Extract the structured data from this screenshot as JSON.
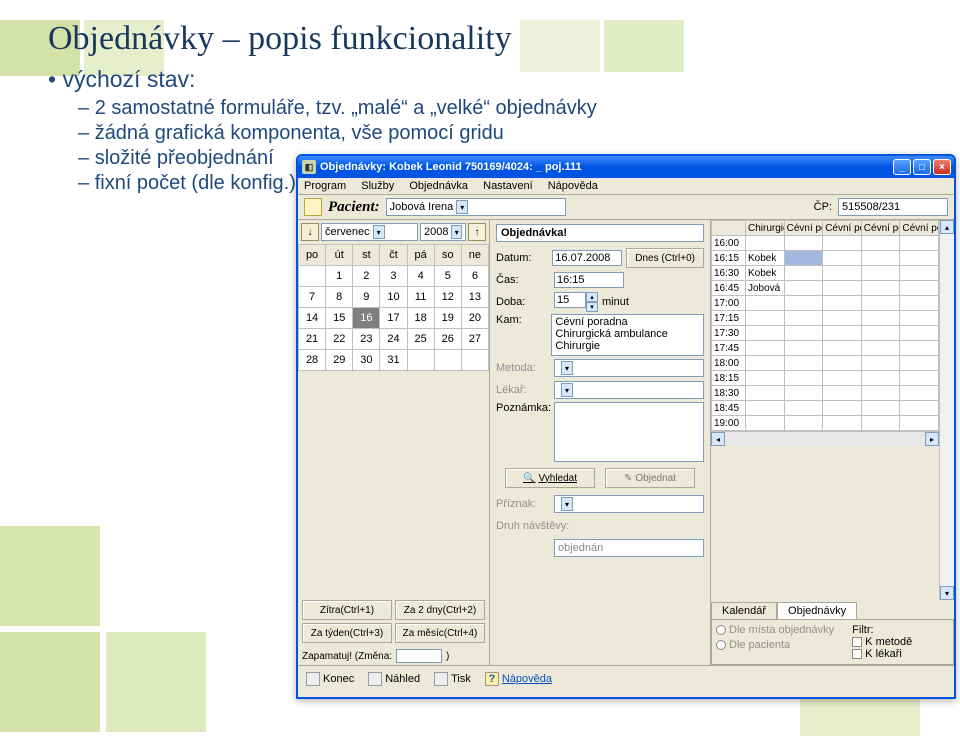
{
  "slide": {
    "title": "Objednávky – popis funkcionality",
    "l1": "výchozí stav:",
    "l2a": "2 samostatné formuláře, tzv. „malé“ a „velké“ objednávky",
    "l2b": "žádná grafická komponenta, vše pomocí gridu",
    "l2c": "složité přeobjednání",
    "l2d": "fixní počet (dle konfig.) objednávek na čas"
  },
  "window": {
    "title": "Objednávky: Kobek Leonid 750169/4024: _ poj.111"
  },
  "menu": [
    "Program",
    "Služby",
    "Objednávka",
    "Nastavení",
    "Nápověda"
  ],
  "toolbar": {
    "pacient_label": "Pacient:",
    "pacient_value": "Jobová Irena",
    "cp_label": "ČP:",
    "cp_value": "515508/231"
  },
  "calendar": {
    "month": "červenec",
    "year": "2008",
    "days": [
      "po",
      "út",
      "st",
      "čt",
      "pá",
      "so",
      "ne"
    ],
    "rows": [
      [
        "",
        "1",
        "2",
        "3",
        "4",
        "5",
        "6"
      ],
      [
        "7",
        "8",
        "9",
        "10",
        "11",
        "12",
        "13"
      ],
      [
        "14",
        "15",
        "16",
        "17",
        "18",
        "19",
        "20"
      ],
      [
        "21",
        "22",
        "23",
        "24",
        "25",
        "26",
        "27"
      ],
      [
        "28",
        "29",
        "30",
        "31",
        "",
        "",
        ""
      ]
    ],
    "selected": "16"
  },
  "quick": {
    "b1": "Zítra(Ctrl+1)",
    "b2": "Za 2 dny(Ctrl+2)",
    "b3": "Za týden(Ctrl+3)",
    "b4": "Za měsíc(Ctrl+4)",
    "zap_label": "Zapamatuj! (Změna:",
    "zap_close": ")"
  },
  "form": {
    "header": "Objednávka!",
    "datum_label": "Datum:",
    "datum_value": "16.07.2008",
    "dnes_btn": "Dnes (Ctrl+0)",
    "cas_label": "Čas:",
    "cas_value": "16:15",
    "doba_label": "Doba:",
    "doba_value": "15",
    "doba_unit": "minut",
    "kam_label": "Kam:",
    "kam_options": [
      "Cévní poradna",
      "Chirurgická ambulance",
      "Chirurgie"
    ],
    "metoda_label": "Metoda:",
    "lekar_label": "Lékař:",
    "poznamka_label": "Poznámka:",
    "vyhledat_btn": "Vyhledat",
    "objednat_btn": "Objednat",
    "priznak_label": "Příznak:",
    "druh_label": "Druh návštěvy:",
    "druh_value": "objednán"
  },
  "grid": {
    "cols": [
      "",
      "Chirurgick",
      "Cévní por",
      "Cévní por",
      "Cévní por",
      "Cévní por"
    ],
    "rows": [
      {
        "t": "16:00",
        "c": [
          "",
          "",
          "",
          "",
          ""
        ]
      },
      {
        "t": "16:15",
        "c": [
          "Kobek",
          "",
          "",
          "",
          ""
        ],
        "sel": 2
      },
      {
        "t": "16:30",
        "c": [
          "Kobek",
          "",
          "",
          "",
          ""
        ]
      },
      {
        "t": "16:45",
        "c": [
          "Jobová",
          "",
          "",
          "",
          ""
        ]
      },
      {
        "t": "17:00",
        "c": [
          "",
          "",
          "",
          "",
          ""
        ]
      },
      {
        "t": "17:15",
        "c": [
          "",
          "",
          "",
          "",
          ""
        ]
      },
      {
        "t": "17:30",
        "c": [
          "",
          "",
          "",
          "",
          ""
        ]
      },
      {
        "t": "17:45",
        "c": [
          "",
          "",
          "",
          "",
          ""
        ]
      },
      {
        "t": "18:00",
        "c": [
          "",
          "",
          "",
          "",
          ""
        ]
      },
      {
        "t": "18:15",
        "c": [
          "",
          "",
          "",
          "",
          ""
        ]
      },
      {
        "t": "18:30",
        "c": [
          "",
          "",
          "",
          "",
          ""
        ]
      },
      {
        "t": "18:45",
        "c": [
          "",
          "",
          "",
          "",
          ""
        ]
      },
      {
        "t": "19:00",
        "c": [
          "",
          "",
          "",
          "",
          ""
        ]
      }
    ]
  },
  "tabs": {
    "t1": "Kalendář",
    "t2": "Objednávky"
  },
  "opts": {
    "r1": "Dle místa objednávky",
    "r2": "Dle pacienta",
    "filtr_label": "Filtr:",
    "c1": "K metodě",
    "c2": "K lékaři"
  },
  "status": {
    "konec": "Konec",
    "nahled": "Náhled",
    "tisk": "Tisk",
    "napoveda": "Nápověda"
  }
}
